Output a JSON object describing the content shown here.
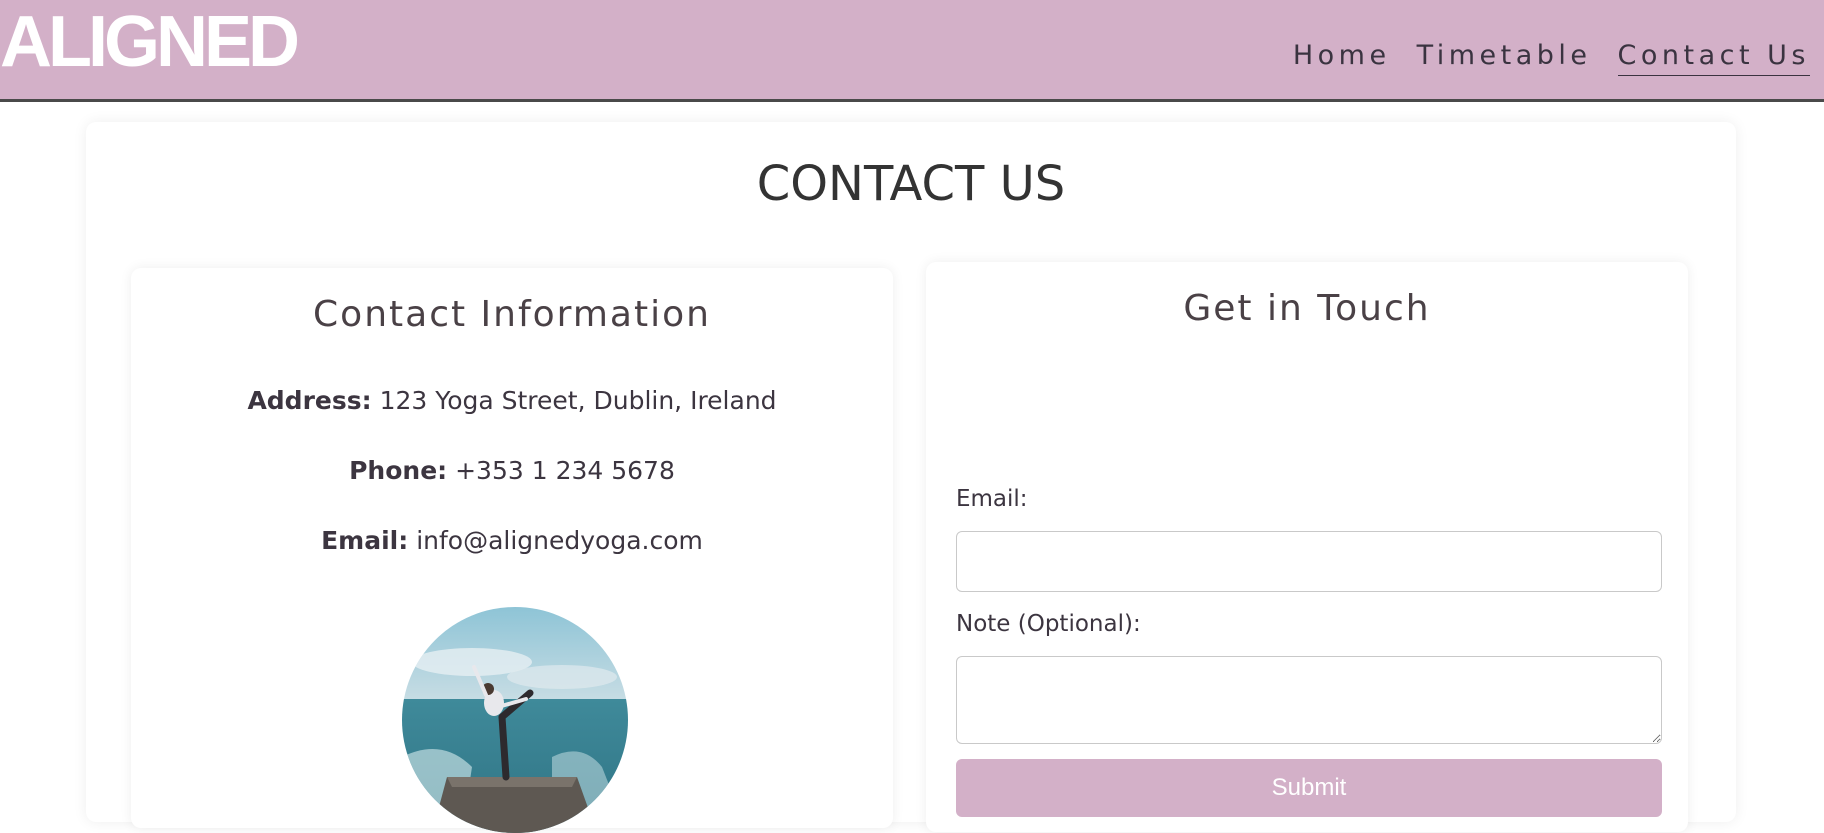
{
  "header": {
    "brand": "ALIGNED",
    "nav": [
      {
        "label": "Home",
        "active": false
      },
      {
        "label": "Timetable",
        "active": false
      },
      {
        "label": "Contact Us",
        "active": true
      }
    ],
    "bg_color": "#d3b0c8"
  },
  "main": {
    "title": "CONTACT US"
  },
  "contact_info": {
    "heading": "Contact Information",
    "address_label": "Address:",
    "address_value": "123 Yoga Street, Dublin, Ireland",
    "phone_label": "Phone:",
    "phone_value": "+353 1 234 5678",
    "email_label": "Email:",
    "email_value": "info@alignedyoga.com",
    "photo_icon": "yoga-pose-photo"
  },
  "form": {
    "heading": "Get in Touch",
    "email_label": "Email:",
    "email_value": "",
    "note_label": "Note (Optional):",
    "note_value": "",
    "submit_label": "Submit",
    "accent_color": "#d3b0c8"
  }
}
